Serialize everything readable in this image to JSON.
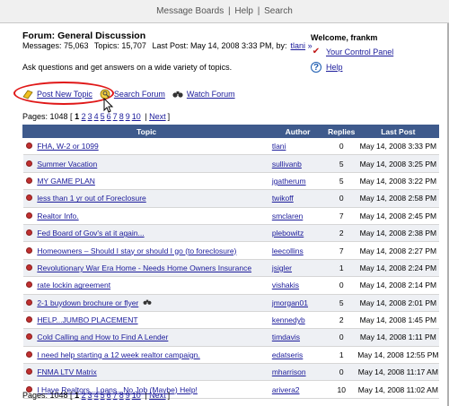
{
  "topbar": {
    "message_boards": "Message Boards",
    "help": "Help",
    "search": "Search",
    "sep": "|"
  },
  "forum": {
    "title": "Forum: General Discussion",
    "messages": "Messages: 75,063",
    "topics": "Topics: 15,707",
    "last_post_prefix": "Last Post: May 14, 2008 3:33 PM, by:",
    "last_post_user": "tlani",
    "last_post_suffix": "»",
    "description": "Ask questions and get answers on a wide variety of topics."
  },
  "sidebar": {
    "welcome": "Welcome, frankm",
    "control_panel": "Your Control Panel",
    "help": "Help"
  },
  "actions": {
    "post_new_topic": "Post New Topic",
    "search_forum": "Search Forum",
    "watch_forum": "Watch Forum"
  },
  "pagination": {
    "prefix": "Pages: 1048 [",
    "current": "1",
    "pages": [
      "2",
      "3",
      "4",
      "5",
      "6",
      "7",
      "8",
      "9",
      "10"
    ],
    "sep": "|",
    "next": "Next",
    "suffix": "]"
  },
  "table": {
    "headers": {
      "topic": "Topic",
      "author": "Author",
      "replies": "Replies",
      "last_post": "Last Post"
    },
    "rows": [
      {
        "topic": "FHA, W-2 or 1099",
        "author": "tlani",
        "replies": "0",
        "last": "May 14, 2008 3:33 PM"
      },
      {
        "topic": "Summer Vacation",
        "author": "sullivanb",
        "replies": "5",
        "last": "May 14, 2008 3:25 PM"
      },
      {
        "topic": "MY GAME PLAN",
        "author": "jgatherum",
        "replies": "5",
        "last": "May 14, 2008 3:22 PM"
      },
      {
        "topic": "less than 1 yr out of Foreclosure",
        "author": "twikoff",
        "replies": "0",
        "last": "May 14, 2008 2:58 PM"
      },
      {
        "topic": "Realtor Info.",
        "author": "smclaren",
        "replies": "7",
        "last": "May 14, 2008 2:45 PM"
      },
      {
        "topic": "Fed Board of Gov's at it again...",
        "author": "plebowitz",
        "replies": "2",
        "last": "May 14, 2008 2:38 PM"
      },
      {
        "topic": "Homeowners – Should I stay or should I go (to foreclosure)",
        "author": "leecollins",
        "replies": "7",
        "last": "May 14, 2008 2:27 PM"
      },
      {
        "topic": "Revolutionary War Era Home - Needs Home Owners Insurance",
        "author": "jsigler",
        "replies": "1",
        "last": "May 14, 2008 2:24 PM"
      },
      {
        "topic": "rate lockin agreement",
        "author": "vishakis",
        "replies": "0",
        "last": "May 14, 2008 2:14 PM"
      },
      {
        "topic": "2-1 buydown brochure or flyer",
        "author": "jmorgan01",
        "replies": "5",
        "last": "May 14, 2008 2:01 PM",
        "watched": true
      },
      {
        "topic": "HELP...JUMBO PLACEMENT",
        "author": "kennedyb",
        "replies": "2",
        "last": "May 14, 2008 1:45 PM"
      },
      {
        "topic": "Cold Calling and How to Find A Lender",
        "author": "timdavis",
        "replies": "0",
        "last": "May 14, 2008 1:11 PM"
      },
      {
        "topic": "I need help starting a 12 week realtor campaign.",
        "author": "edatseris",
        "replies": "1",
        "last": "May 14, 2008 12:55 PM"
      },
      {
        "topic": "FNMA LTV Matrix",
        "author": "mharrison",
        "replies": "0",
        "last": "May 14, 2008 11:17 AM"
      },
      {
        "topic": "I Have Realtors...Loans...No Job (Maybe) Help!",
        "author": "arivera2",
        "replies": "10",
        "last": "May 14, 2008 11:02 AM"
      }
    ]
  },
  "colors": {
    "header_bg": "#3e5a8c",
    "link": "#1a1a9a",
    "highlight": "#e01818"
  }
}
